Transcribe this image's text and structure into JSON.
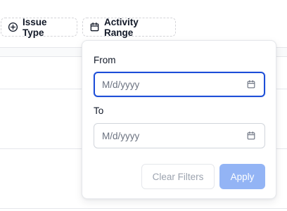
{
  "filters": {
    "issue_type_label": "Issue Type",
    "issue_type_icon": "plus-circle-icon",
    "activity_range_label": "Activity Range",
    "activity_range_icon": "calendar-icon"
  },
  "date_popover": {
    "from_label": "From",
    "from_placeholder": "M/d/yyyy",
    "to_label": "To",
    "to_placeholder": "M/d/yyyy",
    "clear_label": "Clear Filters",
    "apply_label": "Apply"
  },
  "colors": {
    "focus_ring": "#1d4ed8",
    "apply_button_disabled": "#93b4f5",
    "clear_text": "#9ca3af"
  }
}
